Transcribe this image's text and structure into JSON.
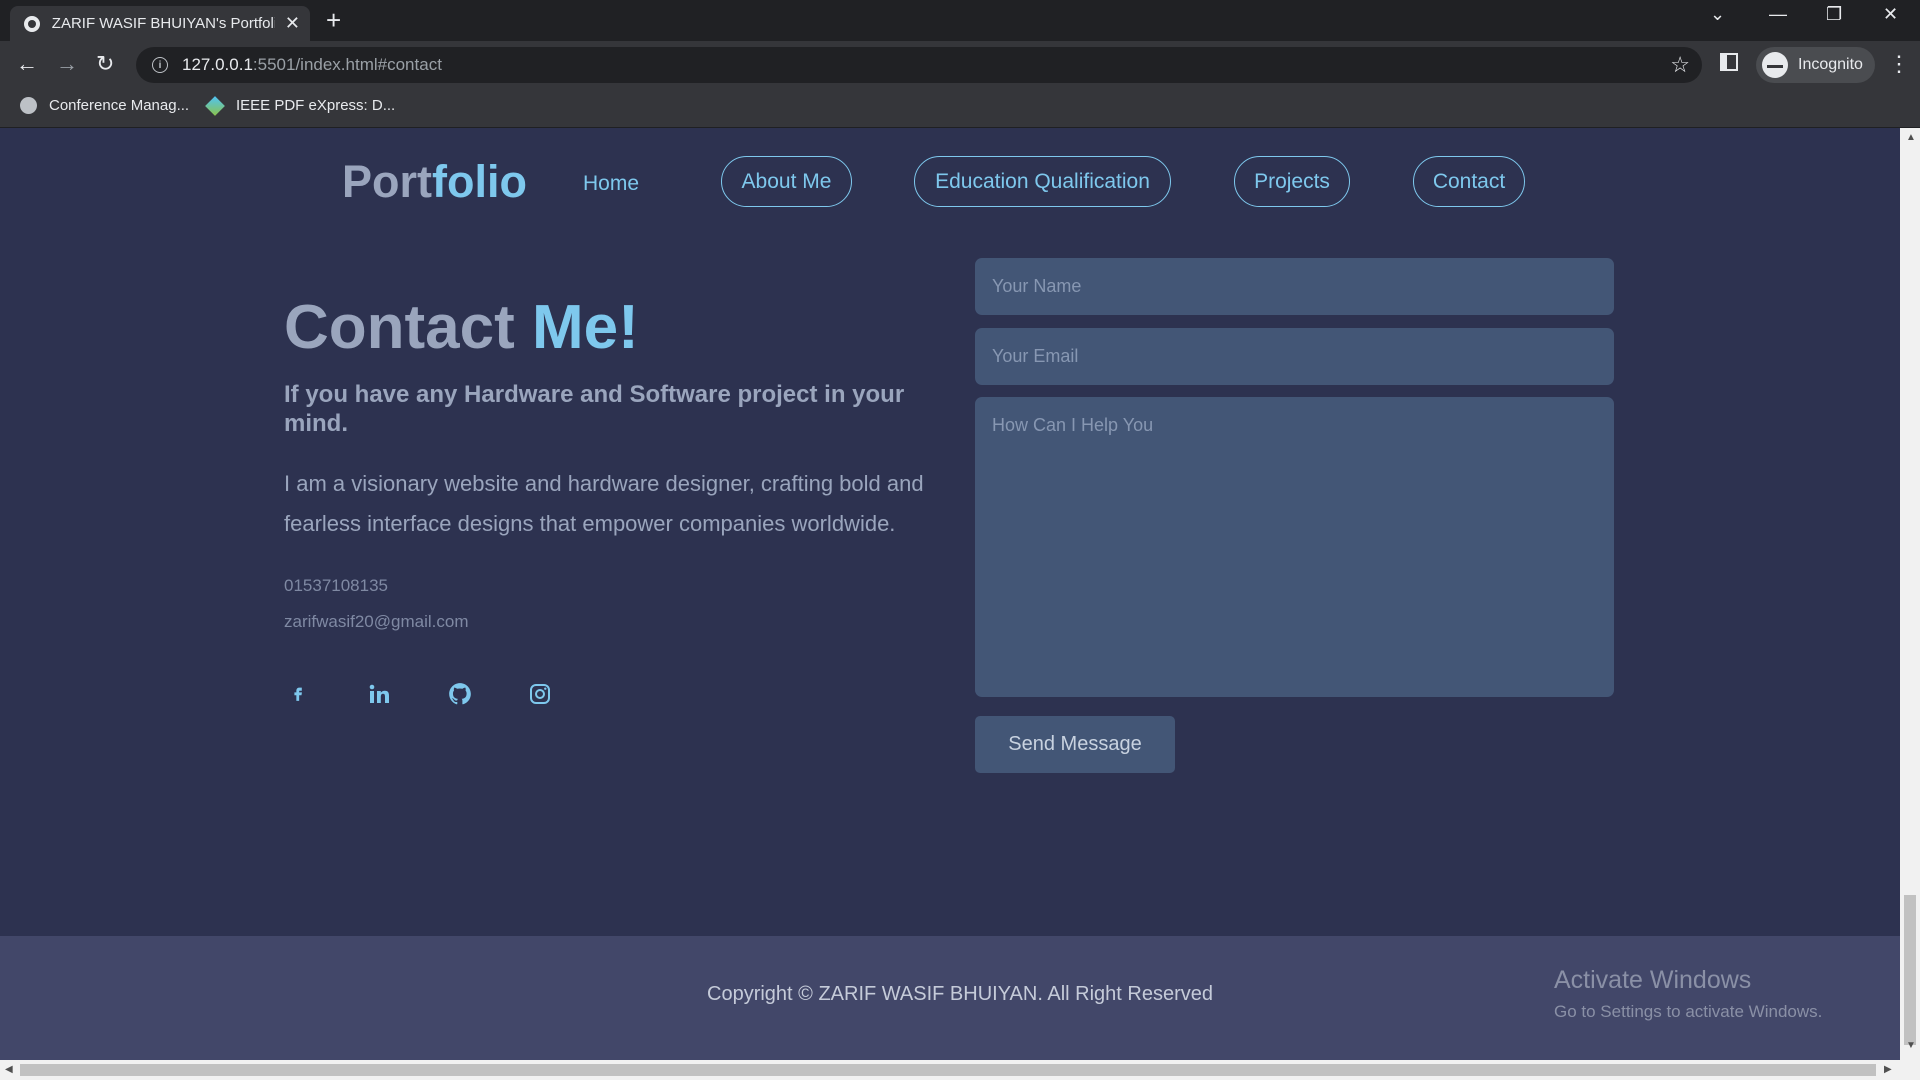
{
  "browser": {
    "tab_title": "ZARIF WASIF BHUIYAN's Portfolio",
    "url_host": "127.0.0.1",
    "url_rest": ":5501/index.html#contact",
    "incognito_label": "Incognito",
    "bookmarks": [
      {
        "label": "Conference Manag..."
      },
      {
        "label": "IEEE PDF eXpress: D..."
      }
    ]
  },
  "site": {
    "logo_main": "Port",
    "logo_accent": "folio",
    "nav": {
      "home": "Home",
      "about": "About Me",
      "education": "Education Qualification",
      "projects": "Projects",
      "contact": "Contact"
    }
  },
  "contact": {
    "title_main": "Contact ",
    "title_accent": "Me!",
    "subtitle": "If you have any Hardware and Software project in your mind.",
    "description": "I am a visionary website and hardware designer, crafting bold and fearless interface designs that empower companies worldwide.",
    "phone": "01537108135",
    "email": "zarifwasif20@gmail.com",
    "social_icons": [
      "facebook-icon",
      "linkedin-icon",
      "github-icon",
      "instagram-icon"
    ]
  },
  "form": {
    "name_placeholder": "Your Name",
    "email_placeholder": "Your Email",
    "message_placeholder": "How Can I Help You",
    "send_label": "Send Message"
  },
  "footer": {
    "copyright": "Copyright © ZARIF WASIF BHUIYAN. All Right Reserved"
  },
  "watermark": {
    "title": "Activate Windows",
    "subtitle": "Go to Settings to activate Windows."
  },
  "colors": {
    "page_bg": "#2d3250",
    "accent": "#7ec8ed",
    "footer_bg": "#424769",
    "field_bg": "#435676"
  }
}
